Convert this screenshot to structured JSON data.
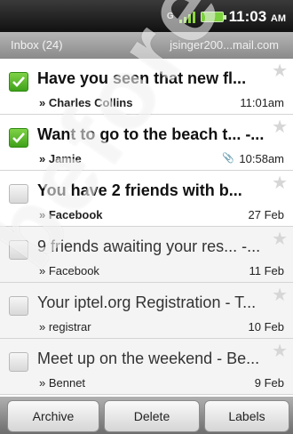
{
  "status": {
    "clock": "11:03",
    "clock_suffix": "AM",
    "network_badge": "G",
    "signal_icon": "signal-bars-icon",
    "battery_icon": "battery-icon"
  },
  "header": {
    "inbox": "Inbox (24)",
    "account": "jsinger200...mail.com"
  },
  "messages": [
    {
      "subject": "Have you seen that new fl...",
      "sender": "» Charles Collins",
      "time": "11:01am",
      "checked": true,
      "read": false
    },
    {
      "subject": "Want to go to the beach t... -...",
      "sender": "» Jamie",
      "time": "10:58am",
      "checked": true,
      "read": false,
      "attachment_icon": "paperclip-icon"
    },
    {
      "subject": "You have 2 friends with b...",
      "sender": "» Facebook",
      "time": "27 Feb",
      "checked": false,
      "read": false
    },
    {
      "subject": "9 friends awaiting your res... -...",
      "sender": "» Facebook",
      "time": "11 Feb",
      "checked": false,
      "read": true
    },
    {
      "subject": "Your iptel.org Registration - T...",
      "sender": "» registrar",
      "time": "10 Feb",
      "checked": false,
      "read": true
    },
    {
      "subject": "Meet up on the weekend - Be...",
      "sender": "» Bennet",
      "time": "9 Feb",
      "checked": false,
      "read": true
    }
  ],
  "actions": {
    "archive": "Archive",
    "delete": "Delete",
    "labels": "Labels"
  },
  "colors": {
    "check_green": "#4cb021",
    "header_gray": "#9e9e9e"
  }
}
